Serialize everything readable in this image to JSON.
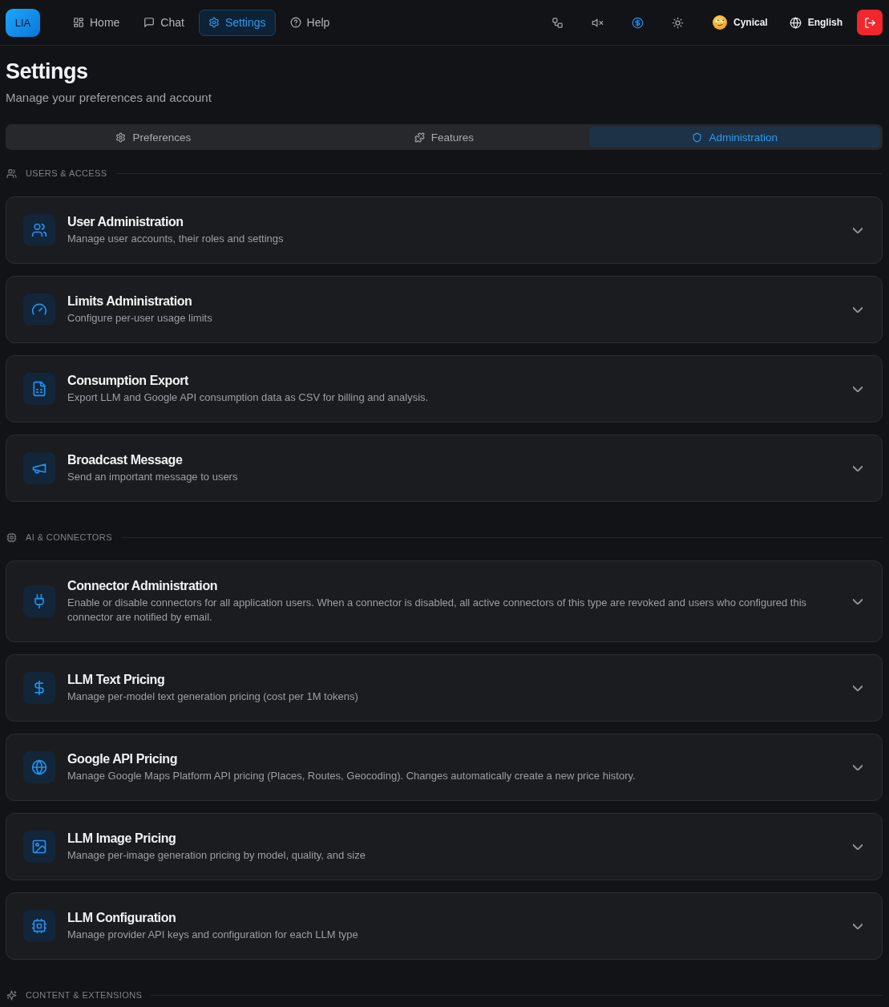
{
  "top_bar": {
    "logo": "LIA",
    "nav": [
      {
        "label": "Home",
        "selected": false
      },
      {
        "label": "Chat",
        "selected": false
      },
      {
        "label": "Settings",
        "selected": true
      },
      {
        "label": "Help",
        "selected": false
      }
    ],
    "toolbar": [
      {
        "active": false
      },
      {
        "active": false
      },
      {
        "active": true
      },
      {
        "active": false
      }
    ],
    "persona": "Cynical",
    "language": "English"
  },
  "page": {
    "title": "Settings",
    "subtitle": "Manage your preferences and account"
  },
  "tabs": [
    {
      "label": "Preferences",
      "selected": false
    },
    {
      "label": "Features",
      "selected": false
    },
    {
      "label": "Administration",
      "selected": true
    }
  ],
  "sections": [
    {
      "title": "USERS & ACCESS",
      "cards": [
        {
          "title": "User Administration",
          "description": "Manage user accounts, their roles and settings",
          "expanded": false
        },
        {
          "title": "Limits Administration",
          "description": "Configure per-user usage limits",
          "expanded": false
        },
        {
          "title": "Consumption Export",
          "description": "Export LLM and Google API consumption data as CSV for billing and analysis.",
          "expanded": false
        },
        {
          "title": "Broadcast Message",
          "description": "Send an important message to users",
          "expanded": false
        }
      ]
    },
    {
      "title": "AI & CONNECTORS",
      "cards": [
        {
          "title": "Connector Administration",
          "description": "Enable or disable connectors for all application users. When a connector is disabled, all active connectors of this type are revoked and users who configured this connector are notified by email.",
          "expanded": false
        },
        {
          "title": "LLM Text Pricing",
          "description": "Manage per-model text generation pricing (cost per 1M tokens)",
          "expanded": false
        },
        {
          "title": "Google API Pricing",
          "description": "Manage Google Maps Platform API pricing (Places, Routes, Geocoding). Changes automatically create a new price history.",
          "expanded": false
        },
        {
          "title": "LLM Image Pricing",
          "description": "Manage per-image generation pricing by model, quality, and size",
          "expanded": false
        },
        {
          "title": "LLM Configuration",
          "description": "Manage provider API keys and configuration for each LLM type",
          "expanded": false
        }
      ]
    },
    {
      "title": "CONTENT & EXTENSIONS"
    }
  ]
}
